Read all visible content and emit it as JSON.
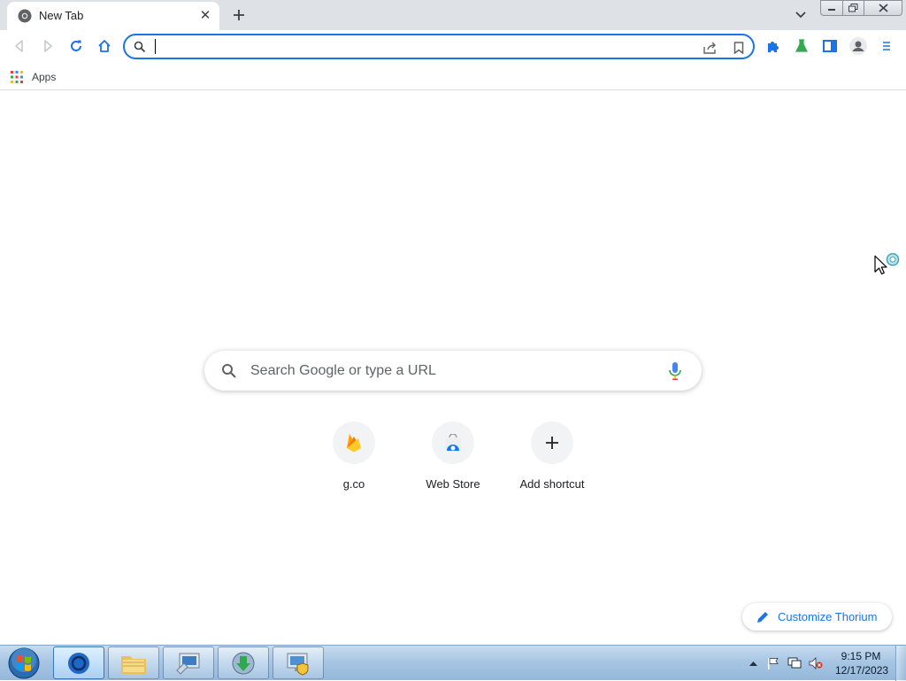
{
  "browser": {
    "tab": {
      "title": "New Tab",
      "close_symbol": "✕"
    },
    "new_tab_symbol": "+",
    "omnibox": {
      "value": "",
      "placeholder": ""
    },
    "bookmarks": {
      "apps_label": "Apps"
    }
  },
  "ntp": {
    "search_placeholder": "Search Google or type a URL",
    "shortcuts": [
      {
        "label": "g.co",
        "icon": "firebase-icon"
      },
      {
        "label": "Web Store",
        "icon": "web-store-icon"
      },
      {
        "label": "Add shortcut",
        "icon": "plus-icon",
        "symbol": "+"
      }
    ],
    "customize_label": "Customize Thorium"
  },
  "taskbar": {
    "items": [
      "start-orb",
      "browser",
      "file-explorer",
      "remote-desktop",
      "download-manager",
      "system-monitor"
    ],
    "clock": {
      "time": "9:15 PM",
      "date": "12/17/2023"
    }
  },
  "colors": {
    "accent": "#1a73e8",
    "tabstrip": "#dee1e6",
    "extension_green": "#34a853"
  }
}
